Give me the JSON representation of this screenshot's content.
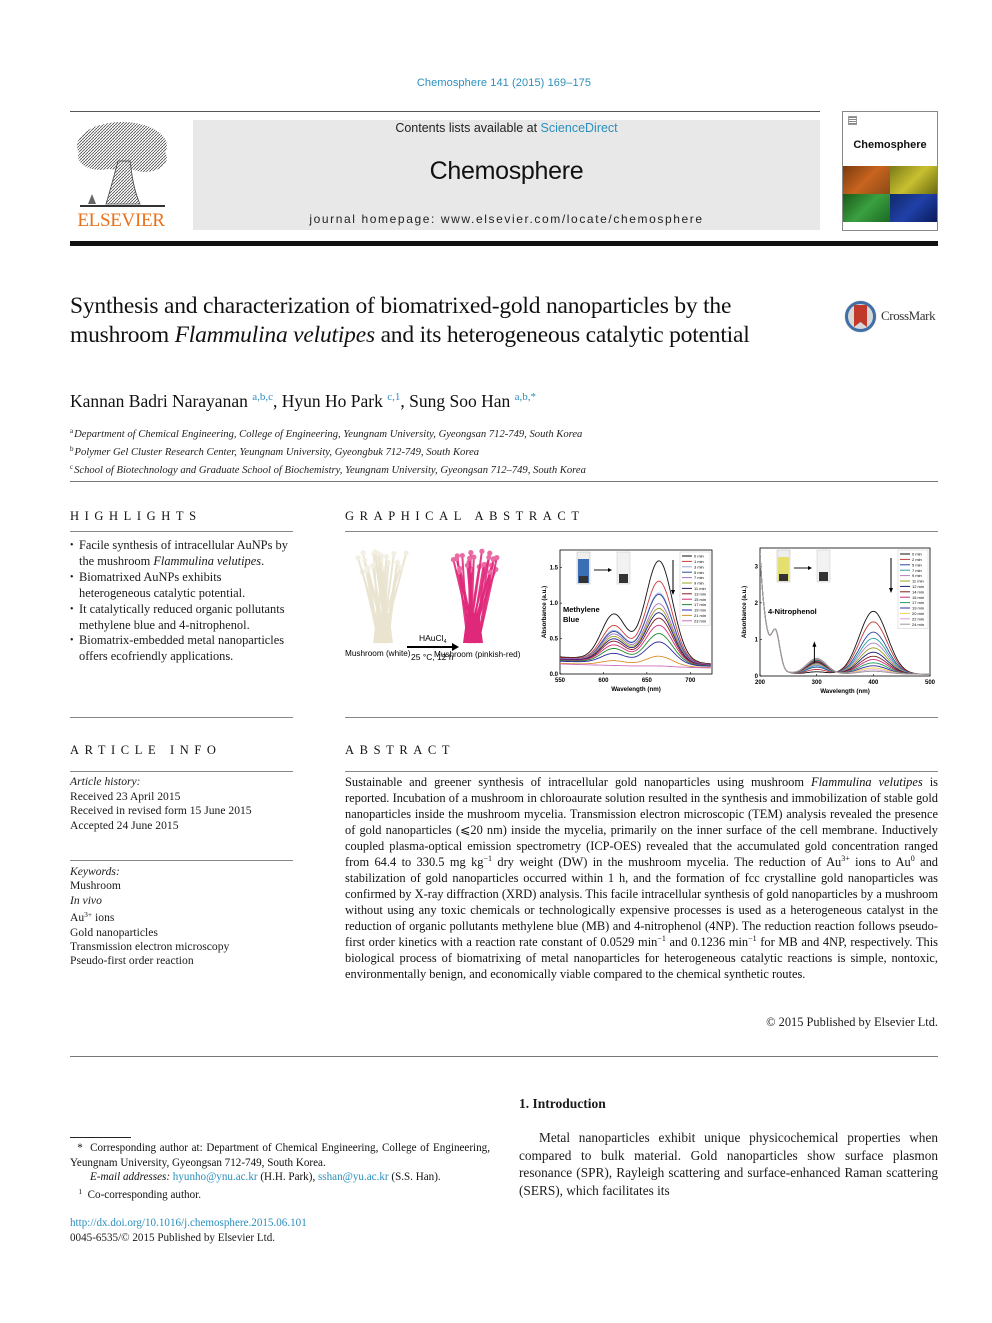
{
  "header": {
    "journal_ref": "Chemosphere 141 (2015) 169–175",
    "contents_prefix": "Contents lists available at ",
    "contents_link": "ScienceDirect",
    "journal_name": "Chemosphere",
    "homepage_prefix": "journal homepage: ",
    "homepage_url": "www.elsevier.com/locate/chemosphere",
    "publisher_logo_text": "ELSEVIER",
    "cover_title": "Chemosphere",
    "colors": {
      "link": "#2a8fbd",
      "elsevier_orange": "#e9711c",
      "masthead_bg": "#e8e8e8"
    }
  },
  "title": {
    "part1": "Synthesis and characterization of biomatrixed-gold nanoparticles by the mushroom ",
    "italic": "Flammulina velutipes",
    "part2": " and its heterogeneous catalytic potential",
    "crossmark_label": "CrossMark"
  },
  "authors": [
    {
      "name": "Kannan Badri Narayanan",
      "sup": "a,b,c",
      "sep": ", "
    },
    {
      "name": "Hyun Ho Park",
      "sup": "c,1",
      "sep": ", "
    },
    {
      "name": "Sung Soo Han",
      "sup": "a,b,*",
      "sep": ""
    }
  ],
  "affiliations": [
    {
      "key": "a",
      "text": "Department of Chemical Engineering, College of Engineering, Yeungnam University, Gyeongsan 712-749, South Korea"
    },
    {
      "key": "b",
      "text": "Polymer Gel Cluster Research Center, Yeungnam University, Gyeongbuk 712-749, South Korea"
    },
    {
      "key": "c",
      "text": "School of Biotechnology and Graduate School of Biochemistry, Yeungnam University, Gyeongsan 712–749, South Korea"
    }
  ],
  "highlights": {
    "heading": "HIGHLIGHTS",
    "items": [
      {
        "pre": "Facile synthesis of intracellular AuNPs by the mushroom ",
        "italic": "Flammulina velutipes",
        "post": "."
      },
      {
        "pre": "Biomatrixed AuNPs exhibits heterogeneous catalytic potential.",
        "italic": "",
        "post": ""
      },
      {
        "pre": "It catalytically reduced organic pollutants methylene blue and 4-nitrophenol.",
        "italic": "",
        "post": ""
      },
      {
        "pre": "Biomatrix-embedded metal nanoparticles offers ecofriendly applications.",
        "italic": "",
        "post": ""
      }
    ]
  },
  "graphical_abstract": {
    "heading": "GRAPHICAL ABSTRACT",
    "reagent": "HAuCl",
    "reagent_sub": "4",
    "conditions": "25 °C, 12 h",
    "label_before": "Mushroom (white)",
    "label_after": "Mushroom (pinkish-red)",
    "colors": {
      "mushroom_white": "#e9e3cf",
      "mushroom_pink": "#e0287a"
    }
  },
  "chart_data": [
    {
      "type": "line",
      "title": "",
      "annotation": "Methylene Blue",
      "xlabel": "Wavelength (nm)",
      "ylabel": "Absorbance (a.u.)",
      "xlim": [
        550,
        725
      ],
      "ylim": [
        0,
        1.75
      ],
      "xticks": [
        550,
        600,
        650,
        700
      ],
      "yticks": [
        0.0,
        0.5,
        1.0,
        1.5
      ],
      "ytick_labels": [
        "0.0",
        "0.5",
        "1.0",
        "1.5"
      ],
      "legend_position": "top-right",
      "peak_shoulder_x": 612,
      "peak_x": 664,
      "series": [
        {
          "name": "0 min",
          "color": "#111111",
          "peak": 1.66,
          "shoulder": 0.99,
          "base": 0.24
        },
        {
          "name": "1 min",
          "color": "#d03a3a",
          "peak": 1.37,
          "shoulder": 0.8,
          "base": 0.23
        },
        {
          "name": "3 min",
          "color": "#9aa8e0",
          "peak": 1.2,
          "shoulder": 0.72,
          "base": 0.22
        },
        {
          "name": "5 min",
          "color": "#2d4a9c",
          "peak": 1.18,
          "shoulder": 0.7,
          "base": 0.22
        },
        {
          "name": "7 min",
          "color": "#a070c0",
          "peak": 1.05,
          "shoulder": 0.66,
          "base": 0.22
        },
        {
          "name": "9 min",
          "color": "#9aa020",
          "peak": 0.98,
          "shoulder": 0.62,
          "base": 0.21
        },
        {
          "name": "11 min",
          "color": "#1d1d7a",
          "peak": 0.92,
          "shoulder": 0.58,
          "base": 0.21
        },
        {
          "name": "13 min",
          "color": "#8a1a2a",
          "peak": 0.84,
          "shoulder": 0.54,
          "base": 0.2
        },
        {
          "name": "15 min",
          "color": "#d0307a",
          "peak": 0.74,
          "shoulder": 0.48,
          "base": 0.2
        },
        {
          "name": "17 min",
          "color": "#1f8a2e",
          "peak": 0.62,
          "shoulder": 0.42,
          "base": 0.19
        },
        {
          "name": "19 min",
          "color": "#2a2aa0",
          "peak": 0.5,
          "shoulder": 0.34,
          "base": 0.18
        },
        {
          "name": "21 min",
          "color": "#d8902a",
          "peak": 0.29,
          "shoulder": 0.22,
          "base": 0.15
        },
        {
          "name": "23 min",
          "color": "#d070c0",
          "peak": 0.15,
          "shoulder": 0.14,
          "base": 0.14
        }
      ],
      "inset": {
        "before_color": "#3a6fb5",
        "after_color": "#f2f2f2"
      }
    },
    {
      "type": "line",
      "title": "",
      "annotation": "4-Nitrophenol",
      "xlabel": "Wavelength (nm)",
      "ylabel": "Absorbance (a.u.)",
      "xlim": [
        200,
        500
      ],
      "ylim": [
        0,
        3.5
      ],
      "xticks": [
        200,
        300,
        400,
        500
      ],
      "yticks": [
        0,
        1,
        2,
        3
      ],
      "ytick_labels": [
        "0",
        "1",
        "2",
        "3"
      ],
      "legend_position": "top-right",
      "peak_x": 400,
      "series": [
        {
          "name": "0 min",
          "color": "#111111",
          "peak": 1.72
        },
        {
          "name": "2 min",
          "color": "#c03a3a",
          "peak": 1.43
        },
        {
          "name": "5 min",
          "color": "#2d4a9c",
          "peak": 1.15
        },
        {
          "name": "7 min",
          "color": "#2aa0a0",
          "peak": 0.98
        },
        {
          "name": "9 min",
          "color": "#b080c8",
          "peak": 0.85
        },
        {
          "name": "11 min",
          "color": "#9aa020",
          "peak": 0.72
        },
        {
          "name": "12 min",
          "color": "#1d1d7a",
          "peak": 0.6
        },
        {
          "name": "14 min",
          "color": "#7a2020",
          "peak": 0.49
        },
        {
          "name": "15 min",
          "color": "#c0307a",
          "peak": 0.4
        },
        {
          "name": "17 min",
          "color": "#1f9a5e",
          "peak": 0.31
        },
        {
          "name": "19 min",
          "color": "#3030a0",
          "peak": 0.23
        },
        {
          "name": "20 min",
          "color": "#f0d050",
          "peak": 0.17
        },
        {
          "name": "22 min",
          "color": "#d8a0d8",
          "peak": 0.12
        },
        {
          "name": "24 min",
          "color": "#999999",
          "peak": 0.08
        }
      ],
      "inset": {
        "before_color": "#e4e070",
        "after_color": "#f2f2f2"
      }
    }
  ],
  "article_info": {
    "heading": "ARTICLE INFO",
    "history_label": "Article history:",
    "history": [
      "Received 23 April 2015",
      "Received in revised form 15 June 2015",
      "Accepted 24 June 2015"
    ],
    "keywords_label": "Keywords:",
    "keywords": [
      {
        "text": "Mushroom",
        "italic": false,
        "sup": "",
        "suffix": ""
      },
      {
        "text": "In vivo",
        "italic": true,
        "sup": "",
        "suffix": ""
      },
      {
        "text": "Au",
        "italic": false,
        "sup": "3+",
        "suffix": " ions"
      },
      {
        "text": "Gold nanoparticles",
        "italic": false,
        "sup": "",
        "suffix": ""
      },
      {
        "text": "Transmission electron microscopy",
        "italic": false,
        "sup": "",
        "suffix": ""
      },
      {
        "text": "Pseudo-first order reaction",
        "italic": false,
        "sup": "",
        "suffix": ""
      }
    ]
  },
  "abstract": {
    "heading": "ABSTRACT",
    "segments": [
      {
        "t": "Sustainable and greener synthesis of intracellular gold nanoparticles using mushroom "
      },
      {
        "t": "Flammulina velutipes",
        "i": true
      },
      {
        "t": " is reported. Incubation of a mushroom in chloroaurate solution resulted in the synthesis and immobilization of stable gold nanoparticles inside the mushroom mycelia. Transmission electron microscopic (TEM) analysis revealed the presence of gold nanoparticles (⩽20 nm) inside the mycelia, primarily on the inner surface of the cell membrane. Inductively coupled plasma-optical emission spectrometry (ICP-OES) revealed that the accumulated gold concentration ranged from 64.4 to 330.5 mg kg"
      },
      {
        "t": "−1",
        "sup": true
      },
      {
        "t": " dry weight (DW) in the mushroom mycelia. The reduction of Au"
      },
      {
        "t": "3+",
        "sup": true
      },
      {
        "t": " ions to Au"
      },
      {
        "t": "0",
        "sup": true
      },
      {
        "t": " and stabilization of gold nanoparticles occurred within 1 h, and the formation of fcc crystalline gold nanoparticles was confirmed by X-ray diffraction (XRD) analysis. This facile intracellular synthesis of gold nanoparticles by a mushroom without using any toxic chemicals or technologically expensive processes is used as a heterogeneous catalyst in the reduction of organic pollutants methylene blue (MB) and 4-nitrophenol (4NP). The reduction reaction follows pseudo-first order kinetics with a reaction rate constant of 0.0529 min"
      },
      {
        "t": "−1",
        "sup": true
      },
      {
        "t": " and 0.1236 min"
      },
      {
        "t": "−1",
        "sup": true
      },
      {
        "t": " for MB and 4NP, respectively. This biological process of biomatrixing of metal nanoparticles for heterogeneous catalytic reactions is simple, nontoxic, environmentally benign, and economically viable compared to the chemical synthetic routes."
      }
    ],
    "copyright": "© 2015 Published by Elsevier Ltd."
  },
  "introduction": {
    "heading": "1. Introduction",
    "text": "Metal nanoparticles exhibit unique physicochemical properties when compared to bulk material. Gold nanoparticles show surface plasmon resonance (SPR), Rayleigh scattering and surface-enhanced Raman scattering (SERS), which facilitates its"
  },
  "footnotes": {
    "corresponding": "Corresponding author at: Department of Chemical Engineering, College of Engineering, Yeungnam University, Gyeongsan 712-749, South Korea.",
    "corresponding_mark": "*",
    "email_label": "E-mail addresses:",
    "emails": [
      {
        "address": "hyunho@ynu.ac.kr",
        "who": "(H.H. Park)"
      },
      {
        "address": "sshan@yu.ac.kr",
        "who": "(S.S. Han)."
      }
    ],
    "co_mark": "1",
    "co_corresponding": "Co-corresponding author.",
    "doi": "http://dx.doi.org/10.1016/j.chemosphere.2015.06.101",
    "issn_line": "0045-6535/© 2015 Published by Elsevier Ltd."
  }
}
